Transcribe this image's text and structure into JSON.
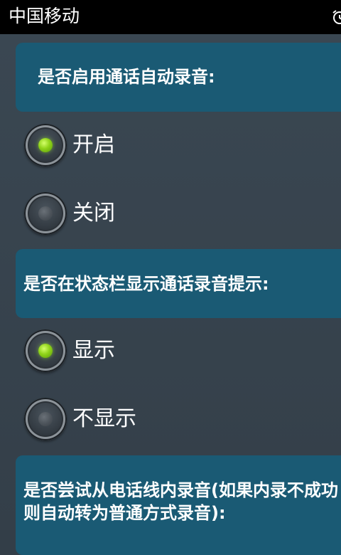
{
  "status_bar": {
    "carrier": "中国移动",
    "alarm_icon": "alarm-clock-icon"
  },
  "sections": [
    {
      "title": "是否启用通话自动录音:",
      "options": [
        {
          "label": "开启",
          "selected": true
        },
        {
          "label": "关闭",
          "selected": false
        }
      ]
    },
    {
      "title": "是否在状态栏显示通话录音提示:",
      "options": [
        {
          "label": "显示",
          "selected": true
        },
        {
          "label": "不显示",
          "selected": false
        }
      ]
    },
    {
      "title": "是否尝试从电话线内录音(如果内录不成功则自动转为普通方式录音):"
    }
  ],
  "colors": {
    "panel": "#1a5a74",
    "background": "#333e48",
    "radio_on": "#8fd319"
  }
}
